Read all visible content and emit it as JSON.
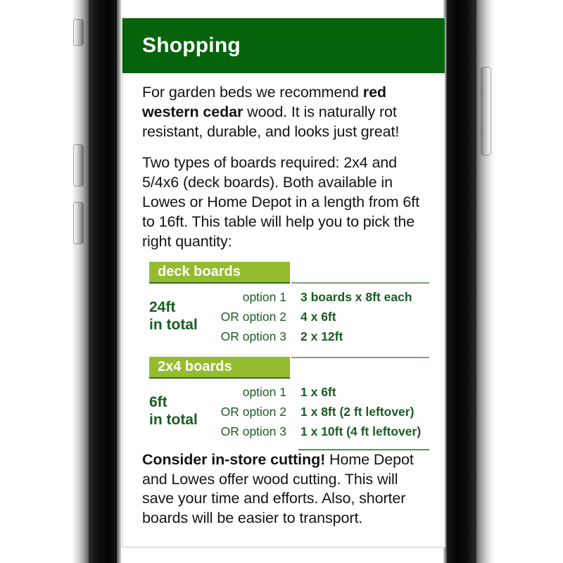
{
  "device": {
    "left_buttons": [
      "silent-switch",
      "volume-up-button",
      "volume-down-button"
    ],
    "right_buttons": [
      "power-button"
    ]
  },
  "app": {
    "header": {
      "title": "Shopping",
      "background_color": "#04630b",
      "text_color": "#ffffff"
    },
    "colors": {
      "header_green": "#04630b",
      "tag_lime": "#95bc2f",
      "table_text_green": "#1a5c22",
      "rule_dark": "#2f6b2b",
      "rule_light": "#7f9e7f"
    },
    "paragraphs": {
      "intro": {
        "before_bold": "For garden beds we recommend ",
        "bold": "red western cedar",
        "after_bold": " wood. It is naturally rot resistant, durable, and looks just great!"
      },
      "boards": "Two types of boards required: 2x4 and 5/4x6 (deck boards). Both available in Lowes or Home Depot in a length from 6ft to 16ft. This table will help you to pick the right quantity:",
      "closing": {
        "bold": "Consider in-store cutting!",
        "rest": " Home Depot and Lowes offer wood cutting. This will save your time and efforts. Also, shorter boards will be easier to transport."
      }
    },
    "tables": [
      {
        "tag": "deck boards",
        "total": "24ft",
        "total_sub": "in total",
        "rows": [
          {
            "option": "option 1",
            "value": "3 boards x 8ft each"
          },
          {
            "option": "OR option 2",
            "value": "4 x 6ft"
          },
          {
            "option": "OR option 3",
            "value": "2 x 12ft"
          }
        ]
      },
      {
        "tag": "2x4 boards",
        "total": "6ft",
        "total_sub": "in total",
        "rows": [
          {
            "option": "option 1",
            "value": "1 x 6ft"
          },
          {
            "option": "OR option 2",
            "value": "1 x 8ft (2 ft leftover)"
          },
          {
            "option": "OR option 3",
            "value": "1 x 10ft (4 ft leftover)"
          }
        ]
      }
    ]
  }
}
